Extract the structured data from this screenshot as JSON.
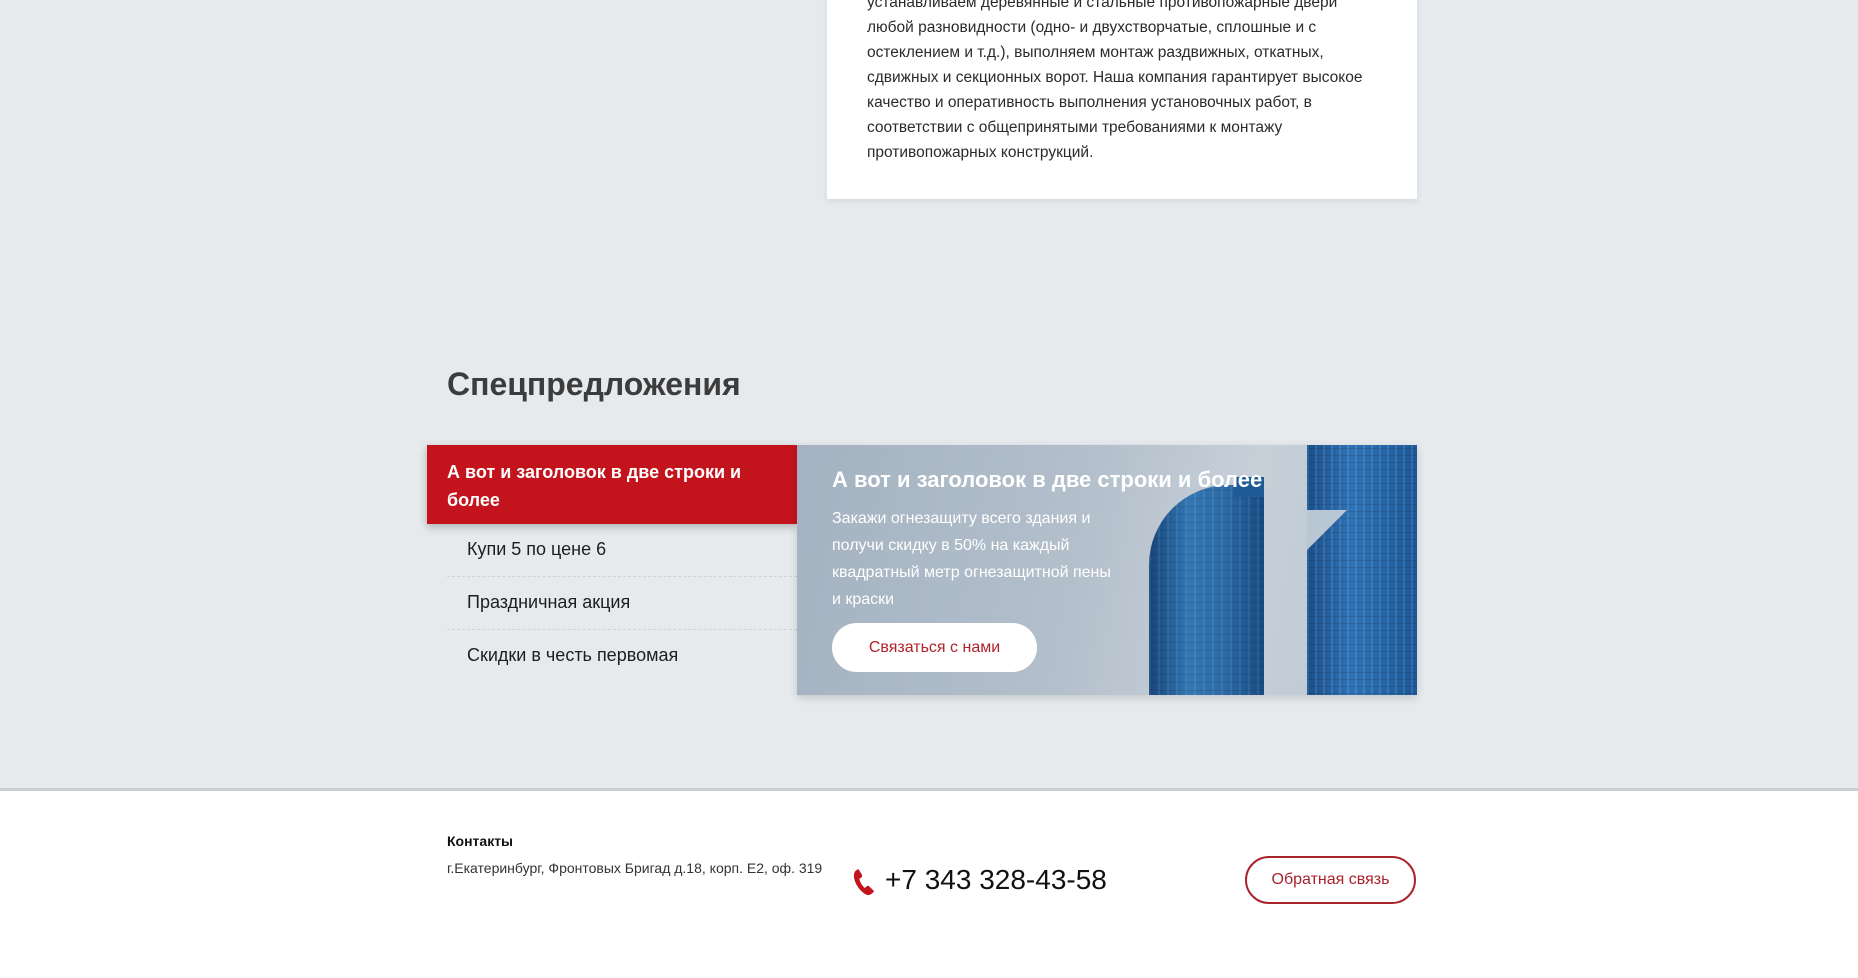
{
  "about": {
    "lines": [
      "устанавливаем деревянные и стальные противопожарные двери",
      "любой разновидности (одно- и двухстворчатые, сплошные и с",
      "остеклением и т.д.), выполняем монтаж раздвижных, откатных,",
      "сдвижных и секционных ворот. Наша компания гарантирует высокое",
      "качество и оперативность выполнения установочных работ, в",
      "соответствии с общепринятыми требованиями к монтажу",
      "противопожарных конструкций."
    ]
  },
  "offers": {
    "title": "Спецпредложения",
    "tabs": [
      "А вот и заголовок в две строки и более",
      "Купи 5 по цене 6",
      "Праздничная акция",
      "Скидки в честь первомая"
    ],
    "banner": {
      "title": "А вот и заголовок в две строки и более",
      "text": "Закажи огнезащиту всего здания и получи скидку в 50% на каждый квадратный метр огнезащитной пены и краски",
      "button": "Связаться с нами"
    }
  },
  "footer": {
    "contacts_heading": "Контакты",
    "address": "г.Екатеринбург, Фронтовых Бригад д.18, корп. Е2, оф. 319",
    "phone": "+7 343 328-43-58",
    "feedback_button": "Обратная связь"
  },
  "colors": {
    "accent": "#c3141d",
    "background": "#e6eaed"
  },
  "icons": {
    "phone": "phone-icon"
  }
}
